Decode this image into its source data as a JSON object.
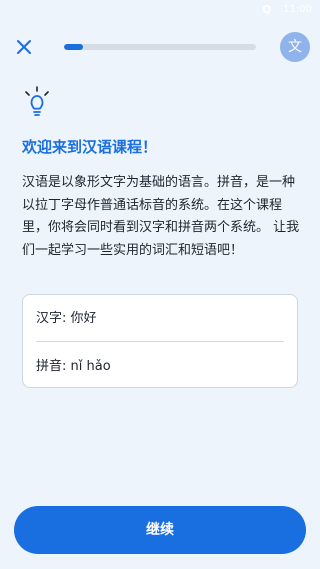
{
  "status_bar": {
    "time": "11:00"
  },
  "top_bar": {
    "progress_percent": 10,
    "lang_label": "文"
  },
  "lesson": {
    "title": "欢迎来到汉语课程！",
    "body": "汉语是以象形文字为基础的语言。拼音，是一种以拉丁字母作普通话标音的系统。在这个课程里，你将会同时看到汉字和拼音两个系统。 让我们一起学习一些实用的词汇和短语吧！",
    "card": {
      "hanzi_row": "汉字: 你好",
      "pinyin_row": "拼音: nǐ hǎo"
    }
  },
  "actions": {
    "continue_label": "继续"
  },
  "colors": {
    "accent": "#1a6fe0",
    "background": "#eef4fc",
    "lang_button": "#8fb3ea"
  },
  "icons": {
    "close": "close-icon",
    "idea": "lightbulb-icon"
  }
}
